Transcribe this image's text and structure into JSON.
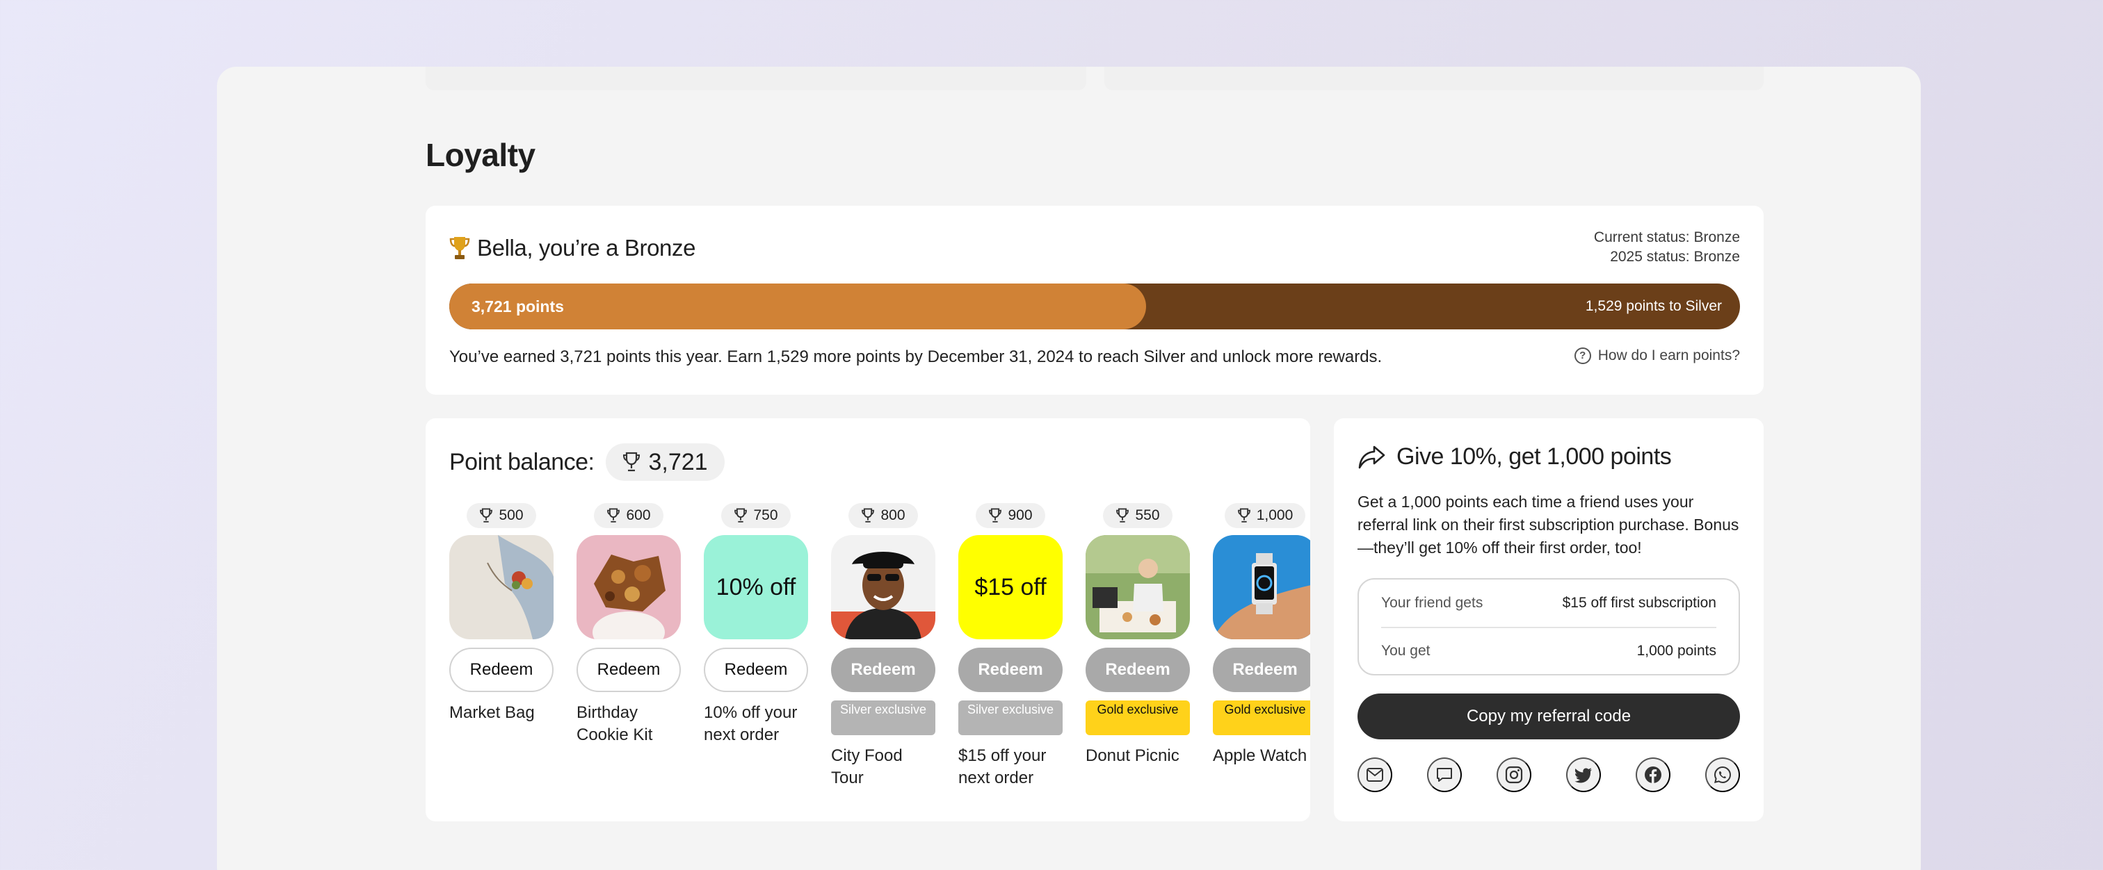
{
  "page": {
    "title": "Loyalty"
  },
  "status": {
    "greeting": "Bella, you’re a Bronze",
    "current_status": "Current status: Bronze",
    "next_status": "2025 status: Bronze",
    "progress_label": "3,721 points",
    "progress_remaining": "1,529 points to Silver",
    "progress_fraction": 0.54,
    "earn_text": "You’ve earned 3,721 points this year. Earn 1,529 more points by December 31, 2024 to reach Silver and unlock more rewards.",
    "help_link": "How do I earn points?",
    "colors": {
      "fill": "#d08236",
      "track": "#6b3f19",
      "trophy": "#e0a21b"
    }
  },
  "balance": {
    "label": "Point balance:",
    "value": "3,721",
    "rewards": [
      {
        "cost": "500",
        "name": "Market Bag",
        "redeem": "Redeem",
        "enabled": true,
        "thumb_text": "",
        "thumb": "market-bag",
        "badge": ""
      },
      {
        "cost": "600",
        "name": "Birthday Cookie Kit",
        "redeem": "Redeem",
        "enabled": true,
        "thumb_text": "",
        "thumb": "cookie-kit",
        "badge": ""
      },
      {
        "cost": "750",
        "name": "10% off your next order",
        "redeem": "Redeem",
        "enabled": true,
        "thumb_text": "10% off",
        "thumb": "mint",
        "badge": ""
      },
      {
        "cost": "800",
        "name": "City Food Tour",
        "redeem": "Redeem",
        "enabled": false,
        "thumb_text": "",
        "thumb": "city-tour",
        "badge": "Silver exclusive",
        "badge_tier": "silver"
      },
      {
        "cost": "900",
        "name": "$15 off your next order",
        "redeem": "Redeem",
        "enabled": false,
        "thumb_text": "$15 off",
        "thumb": "yellow",
        "badge": "Silver exclusive",
        "badge_tier": "silver"
      },
      {
        "cost": "550",
        "name": "Donut Picnic",
        "redeem": "Redeem",
        "enabled": false,
        "thumb_text": "",
        "thumb": "picnic",
        "badge": "Gold exclusive",
        "badge_tier": "gold"
      },
      {
        "cost": "1,000",
        "name": "Apple Watch",
        "redeem": "Redeem",
        "enabled": false,
        "thumb_text": "",
        "thumb": "watch",
        "badge": "Gold exclusive",
        "badge_tier": "gold"
      }
    ]
  },
  "referral": {
    "heading": "Give 10%, get 1,000 points",
    "description": "Get a 1,000 points each time a friend uses your referral link on their first subscription purchase. Bonus—they’ll get 10% off their first order, too!",
    "rows": [
      {
        "label": "Your friend gets",
        "value": "$15 off first subscription"
      },
      {
        "label": "You get",
        "value": "1,000 points"
      }
    ],
    "copy_button": "Copy my referral code",
    "share_icons": [
      "mail-icon",
      "chat-icon",
      "instagram-icon",
      "twitter-icon",
      "facebook-icon",
      "whatsapp-icon"
    ]
  }
}
